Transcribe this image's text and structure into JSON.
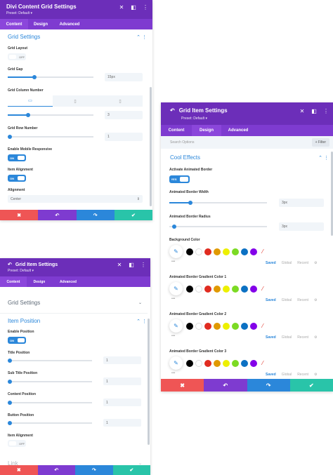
{
  "panel1": {
    "title": "Divi Content Grid Settings",
    "preset": "Preset: Default ▾",
    "tabs": [
      "Content",
      "Design",
      "Advanced"
    ],
    "section_title": "Grid Settings",
    "grid_layout": {
      "label": "Grid Layout",
      "value": "OFF"
    },
    "grid_gap": {
      "label": "Grid Gap",
      "value": "15px"
    },
    "grid_column_number": {
      "label": "Grid Column Number",
      "value": "3"
    },
    "grid_row_number": {
      "label": "Grid Row Number",
      "value": "1"
    },
    "enable_mobile": {
      "label": "Enable Mobile Responsive",
      "value": "ON"
    },
    "item_alignment": {
      "label": "Item Alignment",
      "value": "ON"
    },
    "alignment": {
      "label": "Alignment",
      "value": "Center"
    }
  },
  "panel2": {
    "title": "Grid Item Settings",
    "preset": "Preset: Default ▾",
    "tabs": [
      "Content",
      "Design",
      "Advanced"
    ],
    "search_placeholder": "Search Options",
    "filter_label": "+ Filter",
    "section_title": "Cool Effects",
    "activate_border": {
      "label": "Activate Animated Border",
      "value": "YES"
    },
    "border_width": {
      "label": "Animated Border Width",
      "value": "3px"
    },
    "border_radius": {
      "label": "Animated Border Radius",
      "value": "3px"
    },
    "color_labels": [
      "Background Color",
      "Animated Border Gradient Color 1",
      "Animated Border Gradient Color 2",
      "Animated Border Gradient Color 3"
    ],
    "saved_tabs": [
      "Saved",
      "Global",
      "Recent"
    ]
  },
  "panel3": {
    "title": "Grid Item Settings",
    "preset": "Preset: Default ▾",
    "tabs": [
      "Content",
      "Design",
      "Advanced"
    ],
    "collapsed_section": "Grid Settings",
    "section_title": "Item Position",
    "enable_position": {
      "label": "Enable Position",
      "value": "ON"
    },
    "title_position": {
      "label": "Title Position",
      "value": "1"
    },
    "subtitle_position": {
      "label": "Sub Title Position",
      "value": "1"
    },
    "content_position": {
      "label": "Content Position",
      "value": "1"
    },
    "button_position": {
      "label": "Button Position",
      "value": "1"
    },
    "item_alignment": {
      "label": "Item Alignment",
      "value": "OFF"
    },
    "link_section": "Link"
  },
  "swatch_colors": [
    "#000000",
    "#ffffff",
    "#e02b20",
    "#e09900",
    "#edf000",
    "#7cda24",
    "#0c71c3",
    "#8300e9"
  ],
  "colors": {
    "accent": "#2b87da",
    "header": "#6c2eb9",
    "tabs": "#7e3bd0",
    "cancel": "#ef5555",
    "save": "#29c4a9"
  },
  "icons": [
    "back-arrow-icon",
    "close-icon",
    "split-icon",
    "more-icon",
    "desktop-icon",
    "tablet-icon",
    "phone-icon",
    "eyedropper-icon",
    "gear-icon",
    "undo-icon",
    "redo-icon",
    "check-icon",
    "chevron-up-icon",
    "chevron-down-icon"
  ]
}
